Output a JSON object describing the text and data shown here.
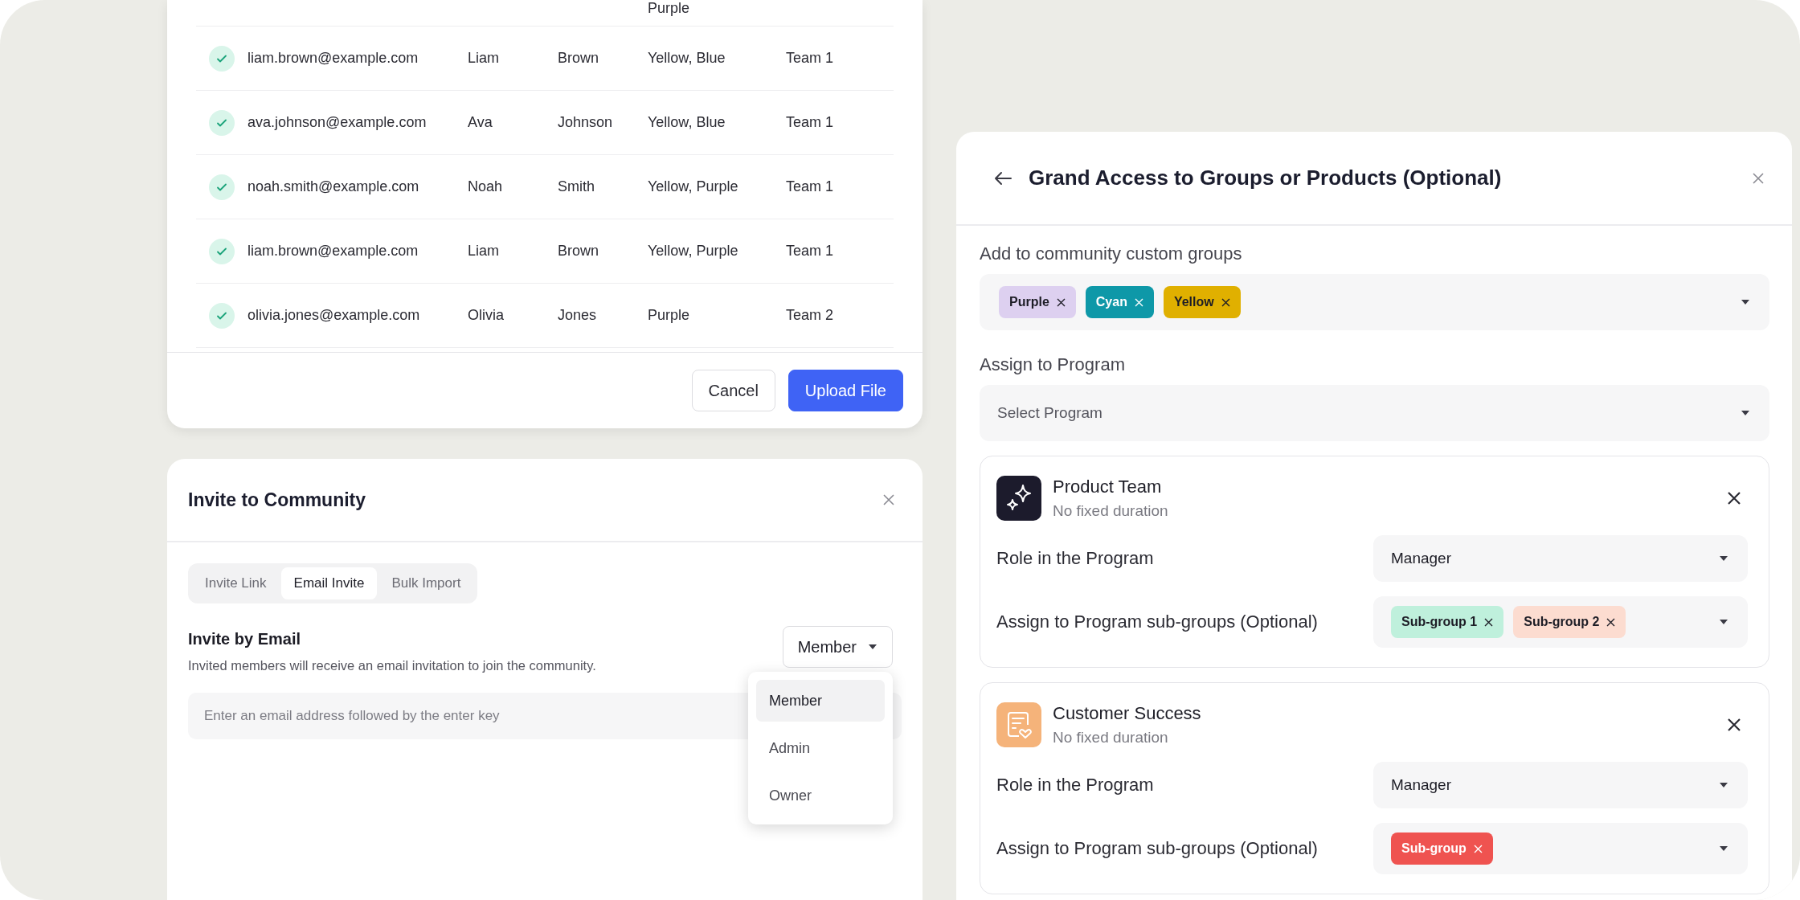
{
  "upload_card": {
    "rows": [
      {
        "groups": "Purple"
      },
      {
        "valid": true,
        "email": "liam.brown@example.com",
        "first": "Liam",
        "last": "Brown",
        "groups": "Yellow, Blue",
        "team": "Team 1"
      },
      {
        "valid": true,
        "email": "ava.johnson@example.com",
        "first": "Ava",
        "last": "Johnson",
        "groups": "Yellow, Blue",
        "team": "Team 1"
      },
      {
        "valid": true,
        "email": "noah.smith@example.com",
        "first": "Noah",
        "last": "Smith",
        "groups": "Yellow, Purple",
        "team": "Team 1"
      },
      {
        "valid": true,
        "email": "liam.brown@example.com",
        "first": "Liam",
        "last": "Brown",
        "groups": "Yellow, Purple",
        "team": "Team 1"
      },
      {
        "valid": true,
        "email": "olivia.jones@example.com",
        "first": "Olivia",
        "last": "Jones",
        "groups": "Purple",
        "team": "Team 2"
      }
    ],
    "buttons": [
      {
        "label": "Cancel",
        "kind": "secondary"
      },
      {
        "label": "Upload File",
        "kind": "primary"
      }
    ]
  },
  "invite_panel": {
    "title": "Invite to Community",
    "tabs": [
      {
        "label": "Invite Link",
        "selected": false
      },
      {
        "label": "Email Invite",
        "selected": true
      },
      {
        "label": "Bulk Import",
        "selected": false
      }
    ],
    "section_title": "Invite by Email",
    "description": "Invited members will receive an email invitation to join the community.",
    "role_select": {
      "value": "Member"
    },
    "email_field": {
      "placeholder": "Enter an email address followed by the enter key"
    },
    "role_menu": [
      {
        "label": "Member",
        "selected": true
      },
      {
        "label": "Admin",
        "selected": false
      },
      {
        "label": "Owner",
        "selected": false
      }
    ]
  },
  "access_panel": {
    "title": "Grand Access to Groups or Products (Optional)",
    "custom_groups": {
      "label": "Add to community custom groups",
      "tags": [
        {
          "label": "Purple",
          "color": "#ddd0f0"
        },
        {
          "label": "Cyan",
          "color": "#0e98a8"
        },
        {
          "label": "Yellow",
          "color": "#e0b000"
        }
      ]
    },
    "program": {
      "label": "Assign to Program",
      "placeholder": "Select Program"
    },
    "programs": [
      {
        "kind": "sparkle",
        "name": "Product Team",
        "duration": "No fixed duration",
        "role_label": "Role in the Program",
        "role": "Manager",
        "subgroups_label": "Assign to Program sub-groups (Optional)",
        "subgroups": [
          {
            "label": "Sub-group 1",
            "color": "#bff0dc"
          },
          {
            "label": "Sub-group 2",
            "color": "#fcdcd0"
          }
        ]
      },
      {
        "kind": "document",
        "name": "Customer Success",
        "duration": "No fixed duration",
        "role_label": "Role in the Program",
        "role": "Manager",
        "subgroups_label": "Assign to Program sub-groups (Optional)",
        "subgroups": [
          {
            "label": "Sub-group",
            "color": "#ef5350"
          }
        ]
      }
    ]
  }
}
